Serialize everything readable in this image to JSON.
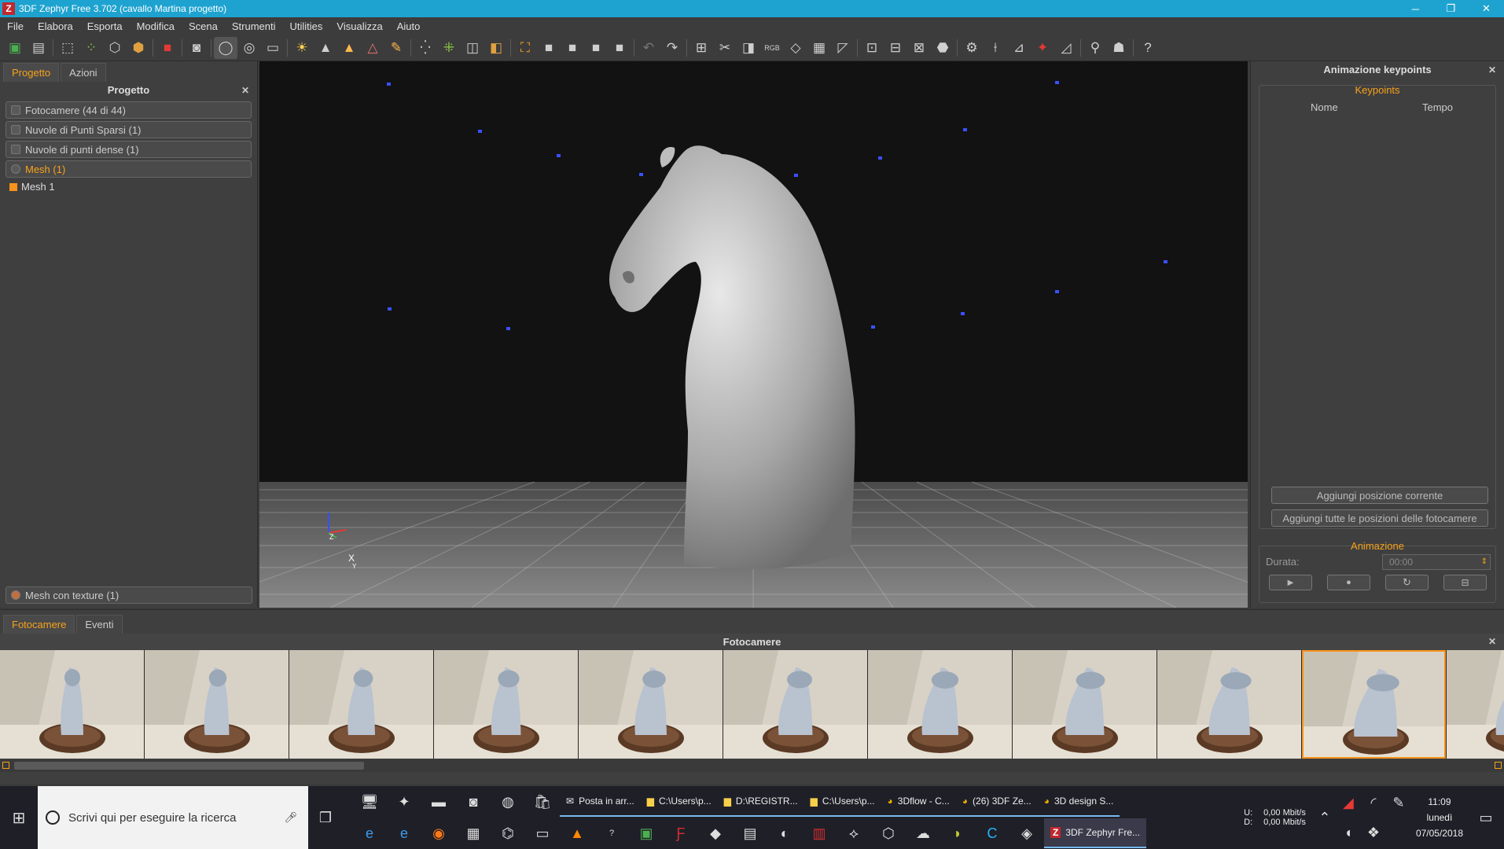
{
  "window": {
    "title": "3DF Zephyr Free 3.702 (cavallo Martina progetto)",
    "app_icon": "Z"
  },
  "menu": [
    "File",
    "Elabora",
    "Esporta",
    "Modifica",
    "Scena",
    "Strumenti",
    "Utilities",
    "Visualizza",
    "Aiuto"
  ],
  "toolbar_icons": [
    "open-icon",
    "save-icon",
    "select-icon",
    "points-icon",
    "cube-icon",
    "cube-color-icon",
    "export-icon",
    "camera-icon",
    "orbit-icon",
    "rotate-icon",
    "wasd-icon",
    "light-icon",
    "mesh-icon",
    "mesh-color-icon",
    "tri-icon",
    "brush-icon",
    "sparse-icon",
    "dense-icon",
    "box-icon",
    "box-color-icon",
    "bbox-icon",
    "rect-icon",
    "rect2-icon",
    "rect3-icon",
    "rect4-icon",
    "undo-icon",
    "redo-icon",
    "tool1-icon",
    "tool2-icon",
    "tool3-icon",
    "rgb-icon",
    "tool4-icon",
    "tool5-icon",
    "tool6-icon",
    "tool7-icon",
    "tool8-icon",
    "tool9-icon",
    "tool10-icon",
    "tool11-icon",
    "ruler-icon",
    "tool12-icon",
    "tool13-icon",
    "tool14-icon",
    "tool15-icon",
    "mask-icon",
    "help-icon"
  ],
  "left_panel": {
    "tabs": [
      "Progetto",
      "Azioni"
    ],
    "title": "Progetto",
    "items": [
      "Fotocamere (44 di 44)",
      "Nuvole di Punti Sparsi (1)",
      "Nuvole di punti dense (1)",
      "Mesh (1)"
    ],
    "mesh_child": "Mesh 1",
    "bottom_item": "Mesh con texture (1)"
  },
  "axes": {
    "z": "Z",
    "x": "X",
    "y": "Y"
  },
  "right_panel": {
    "title": "Animazione keypoints",
    "keypoints_group": "Keypoints",
    "col_name": "Nome",
    "col_time": "Tempo",
    "btn_add_current": "Aggiungi posizione corrente",
    "btn_add_all": "Aggiungi tutte le posizioni delle fotocamere",
    "animation_group": "Animazione",
    "duration_label": "Durata:",
    "duration_value": "00:00"
  },
  "bottom_panel": {
    "tabs": [
      "Fotocamere",
      "Eventi"
    ],
    "title": "Fotocamere",
    "thumb_count": 11,
    "selected_index": 9
  },
  "taskbar": {
    "search_placeholder": "Scrivi qui per eseguire la ricerca",
    "apps": [
      "Posta in arr...",
      "C:\\Users\\p...",
      "D:\\REGISTR...",
      "C:\\Users\\p...",
      "3Dflow - C...",
      "(26) 3DF Ze...",
      "3D design S..."
    ],
    "active_app": "3DF Zephyr Fre...",
    "net_up_label": "U:",
    "net_down_label": "D:",
    "net_up": "0,00 Mbit/s",
    "net_down": "0,00 Mbit/s",
    "time": "11:09",
    "day": "lunedì",
    "date": "07/05/2018"
  },
  "colors": {
    "accent": "#f7a21b",
    "titlebar": "#1ea3d0"
  }
}
